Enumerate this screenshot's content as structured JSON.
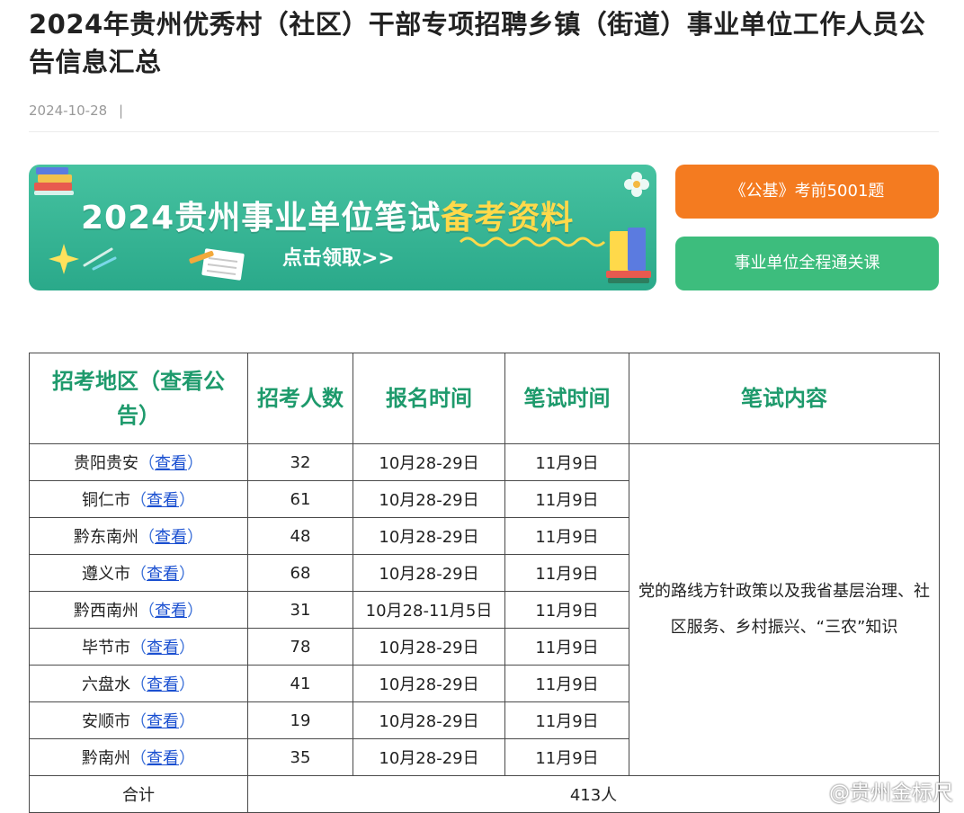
{
  "article": {
    "title": "2024年贵州优秀村（社区）干部专项招聘乡镇（街道）事业单位工作人员公告信息汇总",
    "date": "2024-10-28",
    "date_separator": "|"
  },
  "banner": {
    "title_main": "2024贵州事业单位笔试",
    "title_highlight": "备考资料",
    "subtitle": "点击领取>>"
  },
  "side_buttons": {
    "orange_label": "《公基》考前5001题",
    "green_label": "事业单位全程通关课"
  },
  "table": {
    "headers": [
      "招考地区（查看公告）",
      "招考人数",
      "报名时间",
      "笔试时间",
      "笔试内容"
    ],
    "view_label": "查看",
    "rows": [
      {
        "region": "贵阳贵安",
        "count": "32",
        "signup": "10月28-29日",
        "exam": "11月9日"
      },
      {
        "region": "铜仁市",
        "count": "61",
        "signup": "10月28-29日",
        "exam": "11月9日"
      },
      {
        "region": "黔东南州",
        "count": "48",
        "signup": "10月28-29日",
        "exam": "11月9日"
      },
      {
        "region": "遵义市",
        "count": "68",
        "signup": "10月28-29日",
        "exam": "11月9日"
      },
      {
        "region": "黔西南州",
        "count": "31",
        "signup": "10月28-11月5日",
        "exam": "11月9日"
      },
      {
        "region": "毕节市",
        "count": "78",
        "signup": "10月28-29日",
        "exam": "11月9日"
      },
      {
        "region": "六盘水",
        "count": "41",
        "signup": "10月28-29日",
        "exam": "11月9日"
      },
      {
        "region": "安顺市",
        "count": "19",
        "signup": "10月28-29日",
        "exam": "11月9日"
      },
      {
        "region": "黔南州",
        "count": "35",
        "signup": "10月28-29日",
        "exam": "11月9日"
      }
    ],
    "content": "党的路线方针政策以及我省基层治理、社区服务、乡村振兴、“三农”知识",
    "total_label": "合计",
    "total_value": "413人"
  },
  "watermark": "@贵州金标尺",
  "colors": {
    "header_text": "#1e9a6c",
    "link": "#1a4fd0",
    "orange_button": "#f47b20",
    "green_button": "#3dbd7d",
    "banner_bg": "#2aa98a",
    "banner_highlight": "#ffd94a"
  }
}
